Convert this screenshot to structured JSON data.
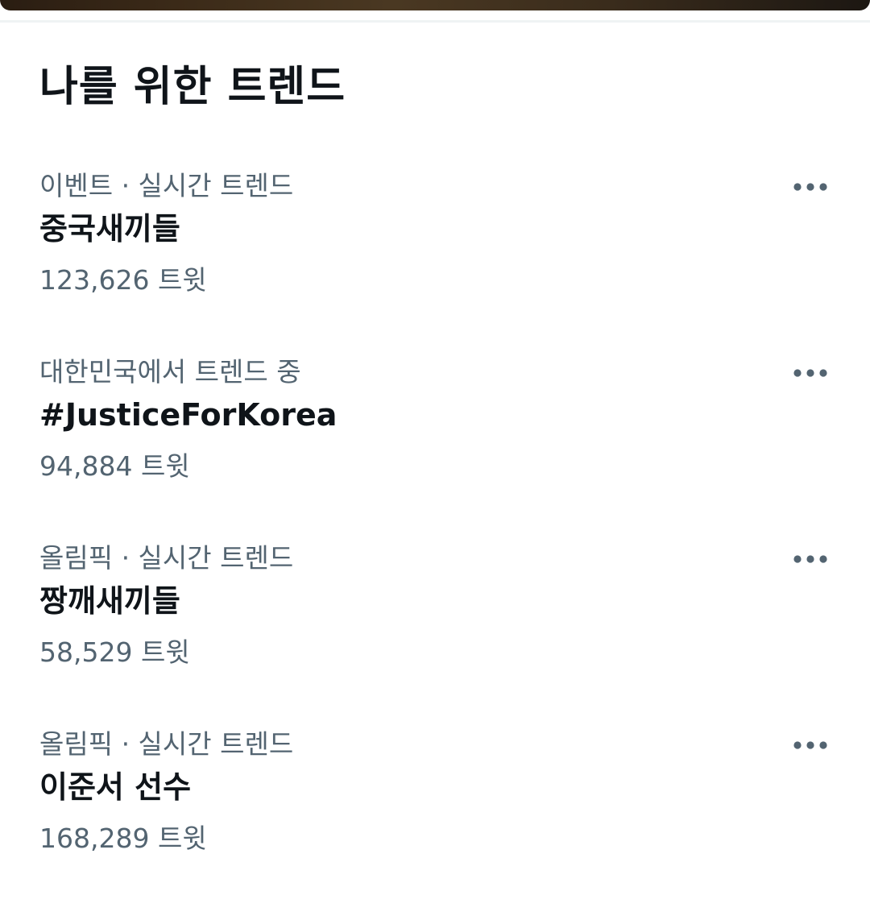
{
  "section": {
    "title": "나를 위한 트렌드"
  },
  "trends": [
    {
      "context": "이벤트 · 실시간 트렌드",
      "name": "중국새끼들",
      "count": "123,626 트윗",
      "more_icon": "more-horizontal-icon"
    },
    {
      "context": "대한민국에서 트렌드 중",
      "name": "#JusticeForKorea",
      "count": "94,884 트윗",
      "more_icon": "more-horizontal-icon"
    },
    {
      "context": "올림픽 · 실시간 트렌드",
      "name": "짱깨새끼들",
      "count": "58,529 트윗",
      "more_icon": "more-horizontal-icon"
    },
    {
      "context": "올림픽 · 실시간 트렌드",
      "name": "이준서 선수",
      "count": "168,289 트윗",
      "more_icon": "more-horizontal-icon"
    }
  ],
  "colors": {
    "primary_text": "#0f1419",
    "secondary_text": "#536471",
    "divider": "#eff3f4",
    "background": "#ffffff"
  }
}
